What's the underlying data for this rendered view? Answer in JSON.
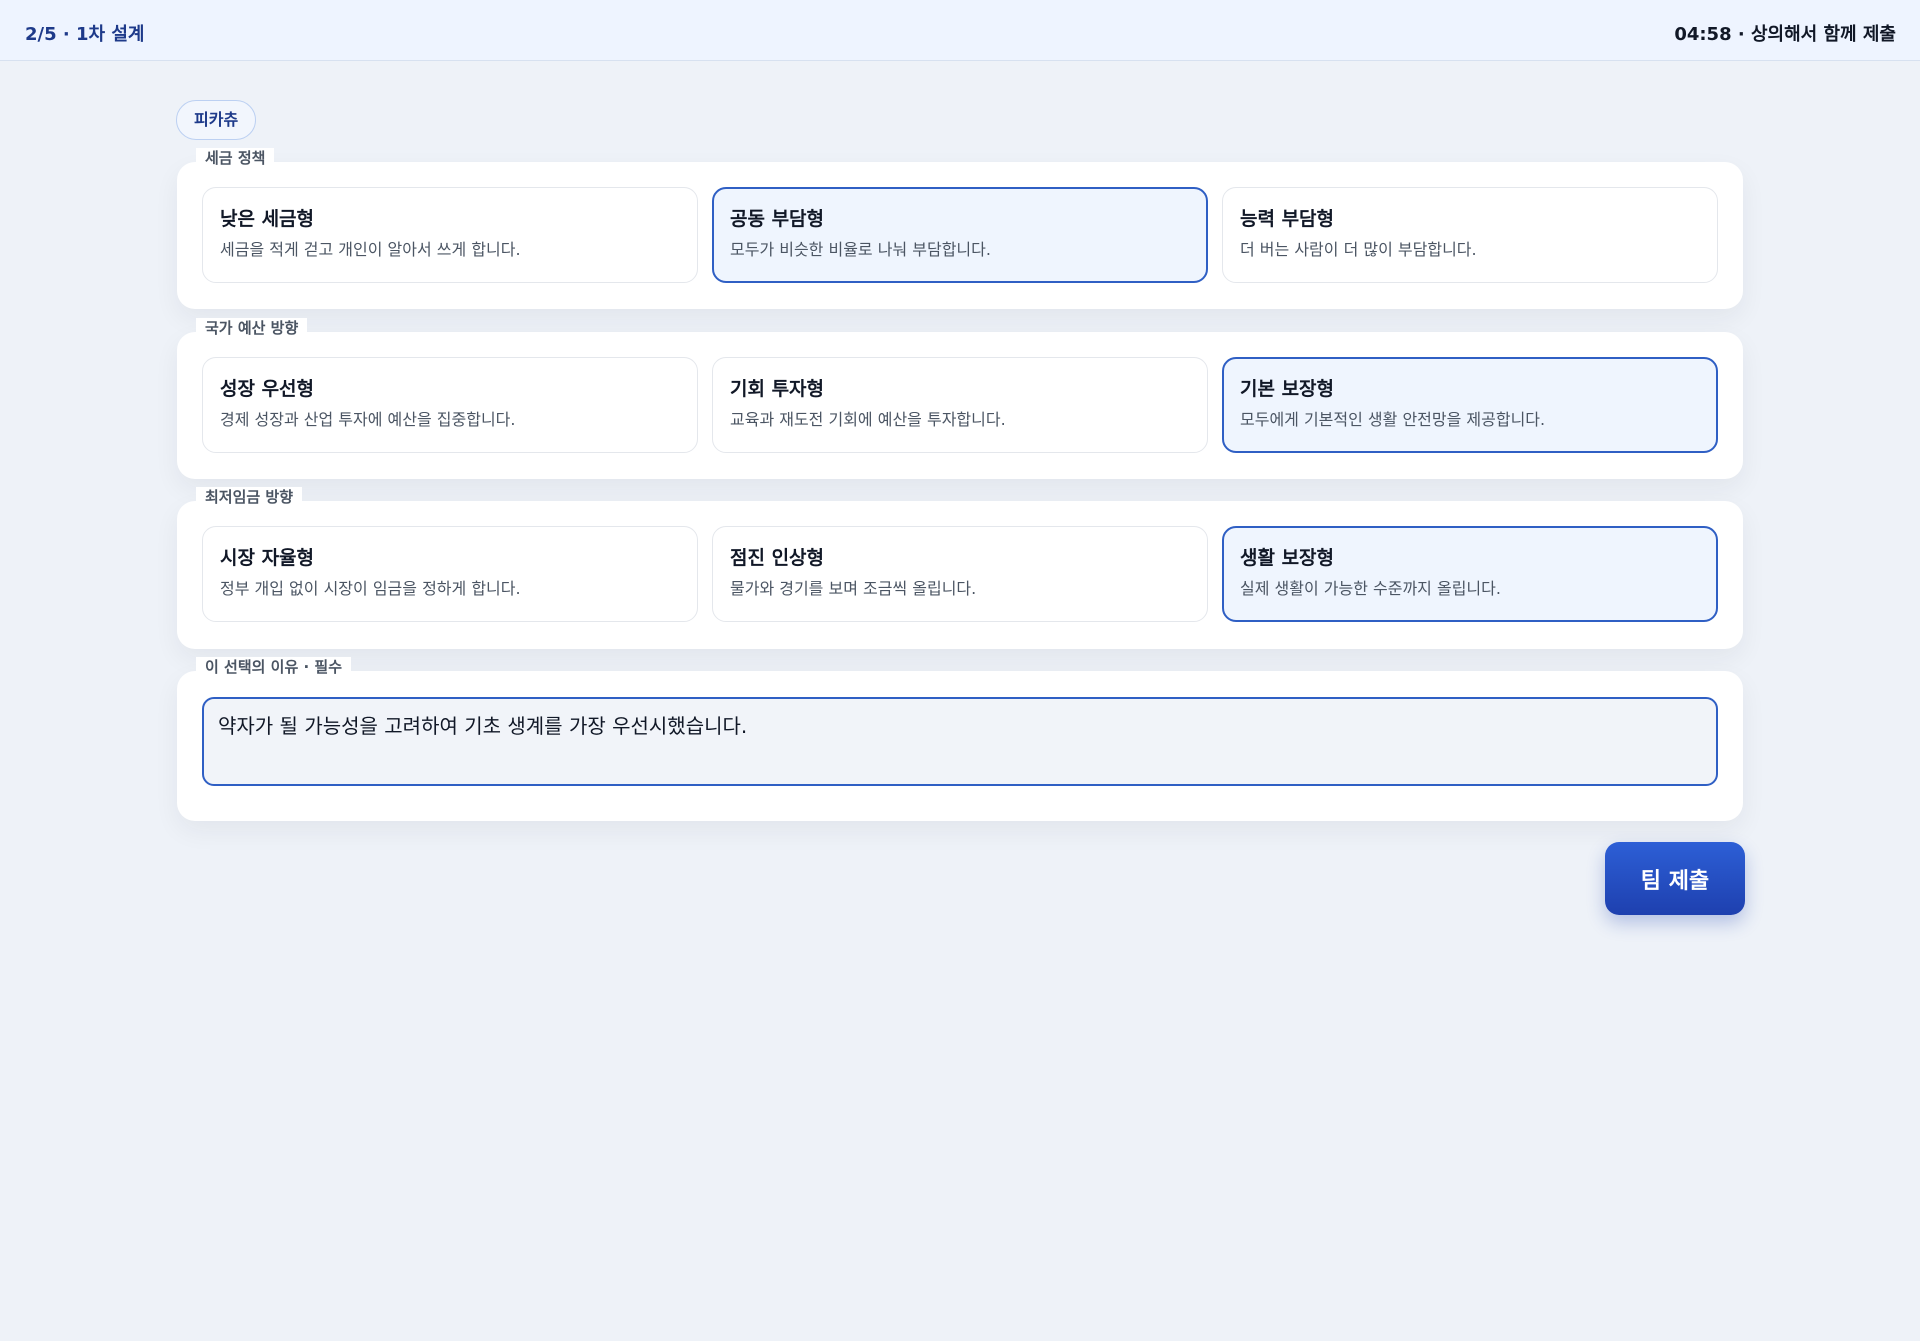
{
  "header": {
    "progress": "2/5 · 1차 설계",
    "status": "04:58 · 상의해서 함께 제출"
  },
  "player": {
    "name": "피카츄"
  },
  "sections": [
    {
      "label": "세금 정책",
      "options": [
        {
          "title": "낮은 세금형",
          "desc": "세금을 적게 걷고 개인이 알아서 쓰게 합니다.",
          "selected": false
        },
        {
          "title": "공동 부담형",
          "desc": "모두가 비슷한 비율로 나눠 부담합니다.",
          "selected": true
        },
        {
          "title": "능력 부담형",
          "desc": "더 버는 사람이 더 많이 부담합니다.",
          "selected": false
        }
      ]
    },
    {
      "label": "국가 예산 방향",
      "options": [
        {
          "title": "성장 우선형",
          "desc": "경제 성장과 산업 투자에 예산을 집중합니다.",
          "selected": false
        },
        {
          "title": "기회 투자형",
          "desc": "교육과 재도전 기회에 예산을 투자합니다.",
          "selected": false
        },
        {
          "title": "기본 보장형",
          "desc": "모두에게 기본적인 생활 안전망을 제공합니다.",
          "selected": true
        }
      ]
    },
    {
      "label": "최저임금 방향",
      "options": [
        {
          "title": "시장 자율형",
          "desc": "정부 개입 없이 시장이 임금을 정하게 합니다.",
          "selected": false
        },
        {
          "title": "점진 인상형",
          "desc": "물가와 경기를 보며 조금씩 올립니다.",
          "selected": false
        },
        {
          "title": "생활 보장형",
          "desc": "실제 생활이 가능한 수준까지 올립니다.",
          "selected": true
        }
      ]
    }
  ],
  "reason": {
    "label": "이 선택의 이유 · 필수",
    "value": "약자가 될 가능성을 고려하여 기초 생계를 가장 우선시했습니다."
  },
  "submit": {
    "label": "팀 제출"
  },
  "colors": {
    "accent": "#2f5fc4",
    "selected_bg": "#eff5fe",
    "button": "#1e40af"
  }
}
